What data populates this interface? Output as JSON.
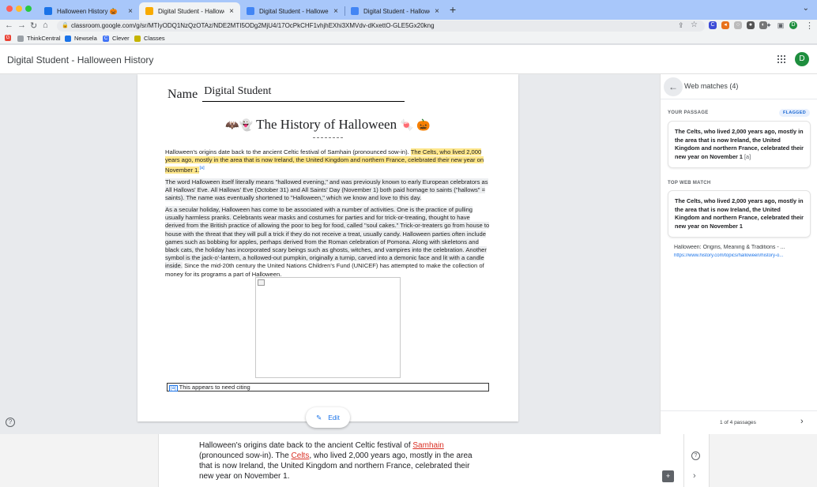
{
  "browser": {
    "tabs": [
      {
        "label": "Halloween History 🎃",
        "favicon_color": "#1a73e8",
        "active": false
      },
      {
        "label": "Digital Student - Halloween His",
        "favicon_color": "#f9ab00",
        "active": true
      },
      {
        "label": "Digital Student - Halloween His",
        "favicon_color": "#4285f4",
        "active": false
      },
      {
        "label": "Digital Student - Halloween His",
        "favicon_color": "#4285f4",
        "active": false
      }
    ],
    "url": "classroom.google.com/g/sr/MTIyODQ1NzQzOTAz/NDE2MTI5ODg2MjU4/17OcPkCHF1vhjhEXhi3XMVdv-dKxettO-GLE5Gx20kng",
    "profile_initial": "D",
    "bookmarks": [
      "ThinkCentral",
      "Newsela",
      "Clever",
      "Classes"
    ]
  },
  "app": {
    "title": "Digital Student - Halloween History",
    "avatar_initial": "D",
    "accent": "#1a73e8"
  },
  "doc": {
    "name_label": "Name",
    "name_value": "Digital  Student",
    "title_emoji_left": "🦇👻",
    "title": "The History of Halloween",
    "title_emoji_right": "🍬 🎃",
    "p1_plain": "Halloween's origins date back to the ancient Celtic festival of Samhain (pronounced sow-in). ",
    "p1_flagged": "The Celts, who lived 2,000 years ago, mostly in the area that is now Ireland, the United Kingdom and northern France, celebrated their new year on November 1.",
    "p1_ref": "[a]",
    "p2": "The word Halloween itself literally means \"hallowed evening,\" and was previously known to early European celebrators as All Hallows' Eve. All Hallows' Eve (October 31) and All Saints' Day (November 1) both paid homage to saints (\"hallows\" = saints). The name was eventually shortened to \"Halloween,\" which we know and love to this day.",
    "p3_grey": "As a secular holiday, Halloween has come to be associated with a number of activities. One is the practice of pulling usually harmless pranks. Celebrants wear masks and costumes for parties and for trick-or-treating, thought to have derived from the British practice of allowing the poor to beg for food, called \"soul cakes.\" Trick-or-treaters go from house to house with the threat that they will pull a trick if they do not receive a treat, usually candy. Halloween parties often include games such as bobbing for apples, perhaps derived from the Roman celebration of Pomona. Along with skeletons and black cats, the holiday has incorporated scary beings such as ghosts, witches, and vampires into the celebration. Another symbol is the jack-o'-lantern, a hollowed-out pumpkin, originally a turnip, carved into a demonic face and lit with a candle inside.",
    "p3_plain": " Since the mid-20th century the United Nations Children's Fund (UNICEF) has attempted to make the collection of money for its programs a part of Halloween.",
    "citation_ref": "[a]",
    "citation_text": "This appears to need citing",
    "edit_label": "Edit"
  },
  "panel": {
    "title": "Web matches (4)",
    "your_passage_label": "YOUR PASSAGE",
    "flag_label": "FLAGGED",
    "your_passage_text": "The Celts, who lived 2,000 years ago, mostly in the area that is now Ireland, the United Kingdom and northern France, celebrated their new year on November 1",
    "your_passage_ref": "[a]",
    "top_match_label": "TOP WEB MATCH",
    "top_match_text": "The Celts, who lived 2,000 years ago, mostly in the area that is now Ireland, the United Kingdom and northern France, celebrated their new year on November 1",
    "source_title": "Halloween: Origins, Meaning & Traditions - ...",
    "source_url": "https://www.history.com/topics/halloween/history-o...",
    "passages": "1 of 4 passages"
  },
  "underdoc": {
    "t1": "Halloween's origins date back to the ancient Celtic festival of ",
    "t1_link": "Samhain",
    "t2": " (pronounced sow-in). The ",
    "t2_link": "Celts",
    "t3": ", who lived 2,000 years ago, mostly in the area that is now Ireland, the United Kingdom and northern France, celebrated their new year on November 1."
  }
}
